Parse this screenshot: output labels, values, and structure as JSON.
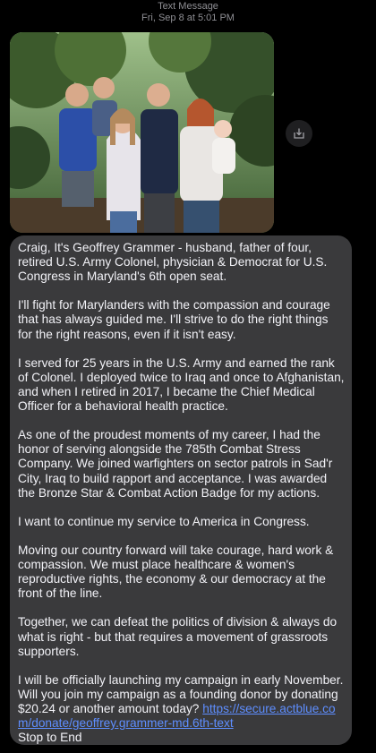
{
  "header": {
    "type_label": "Text Message",
    "timestamp": "Fri, Sep 8 at 5:01 PM"
  },
  "attachment": {
    "kind": "photo",
    "save_icon": "share-download-icon"
  },
  "message": {
    "paragraphs": [
      "Craig, It's Geoffrey Grammer - husband, father of four, retired U.S. Army Colonel, physician & Democrat for U.S. Congress in Maryland's 6th open seat.",
      "I'll fight for Marylanders with the compassion and courage that has always guided me. I'll strive to do the right things for the right reasons, even if it isn't easy.",
      "I served for 25 years in the U.S. Army and earned the rank of Colonel. I deployed twice to Iraq and once to Afghanistan, and when I retired in 2017, I became the Chief Medical Officer for a behavioral health practice.",
      "As one of the proudest moments of my career, I had the honor of serving alongside the 785th Combat Stress Company. We joined warfighters on sector patrols in Sad'r City, Iraq to build rapport and acceptance. I was awarded the Bronze Star & Combat Action Badge for my actions.",
      "I want to continue my service to America in Congress.",
      "Moving our country forward will take courage, hard work & compassion. We must place healthcare & women's reproductive rights, the economy & our democracy at the front of the line.",
      "Together, we can defeat the politics of division & always do what is right -  but that requires a movement of grassroots supporters."
    ],
    "closing_text": "I will be officially launching my campaign in early November. Will you join my campaign as a founding donor by donating $20.24 or another amount today? ",
    "link_text": "https://secure.actblue.com/donate/geoffrey.grammer-md.6th-text",
    "stop_text": "Stop to End"
  },
  "colors": {
    "background": "#000000",
    "bubble": "#3a3a3c",
    "text": "#f2f2f7",
    "meta": "#8e8e93",
    "link": "#5e8eff"
  }
}
